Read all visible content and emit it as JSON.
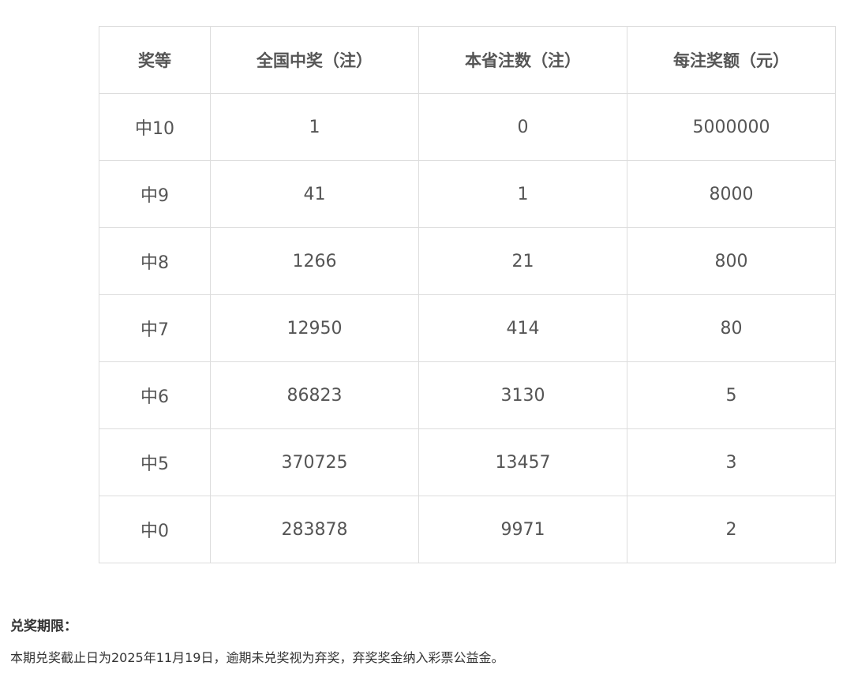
{
  "table": {
    "headers": [
      "奖等",
      "全国中奖（注）",
      "本省注数（注）",
      "每注奖额（元）"
    ],
    "rows": [
      [
        "中10",
        "1",
        "0",
        "5000000"
      ],
      [
        "中9",
        "41",
        "1",
        "8000"
      ],
      [
        "中8",
        "1266",
        "21",
        "800"
      ],
      [
        "中7",
        "12950",
        "414",
        "80"
      ],
      [
        "中6",
        "86823",
        "3130",
        "5"
      ],
      [
        "中5",
        "370725",
        "13457",
        "3"
      ],
      [
        "中0",
        "283878",
        "9971",
        "2"
      ]
    ]
  },
  "deadline": {
    "title": "兑奖期限：",
    "text": "本期兑奖截止日为2025年11月19日，逾期未兑奖视为弃奖，弃奖奖金纳入彩票公益金。"
  },
  "colors": {
    "border": "#dddddd",
    "text": "#555555",
    "note_text": "#333333"
  }
}
